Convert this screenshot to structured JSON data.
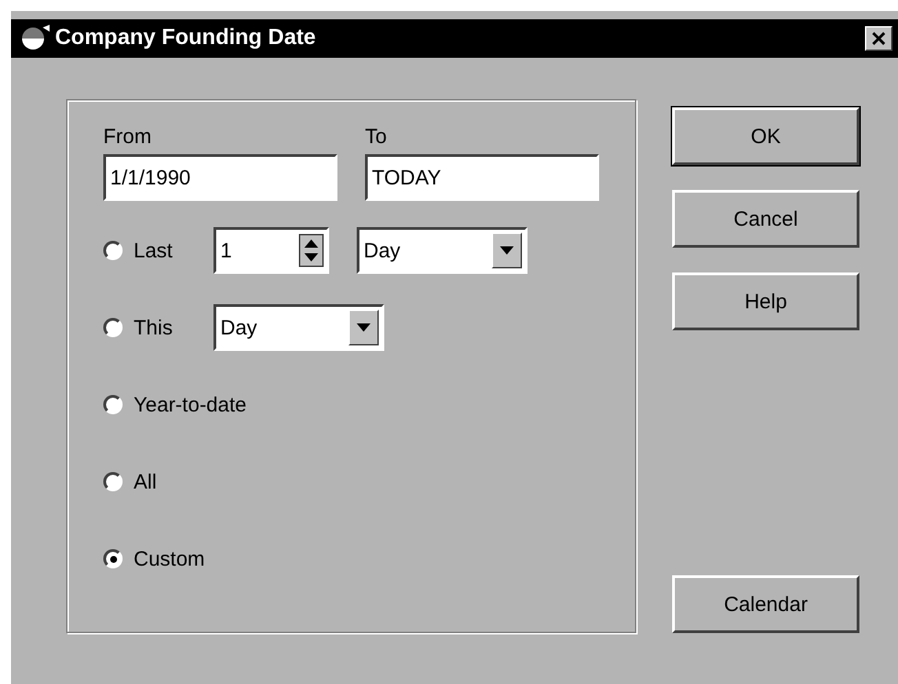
{
  "window": {
    "title": "Company Founding Date"
  },
  "range": {
    "from": {
      "label": "From",
      "value": "1/1/1990"
    },
    "to": {
      "label": "To",
      "value": "TODAY"
    }
  },
  "options": [
    {
      "kind": "last",
      "label": "Last",
      "selected": false,
      "count": "1",
      "unit": "Day"
    },
    {
      "kind": "this",
      "label": "This",
      "selected": false,
      "unit": "Day"
    },
    {
      "kind": "plain",
      "label": "Year-to-date",
      "selected": false
    },
    {
      "kind": "plain",
      "label": "All",
      "selected": false
    },
    {
      "kind": "plain",
      "label": "Custom",
      "selected": true
    }
  ],
  "buttons": [
    {
      "label": "OK",
      "default": true
    },
    {
      "label": "Cancel",
      "default": false
    },
    {
      "label": "Help",
      "default": false
    }
  ],
  "calendar_button": {
    "label": "Calendar"
  }
}
